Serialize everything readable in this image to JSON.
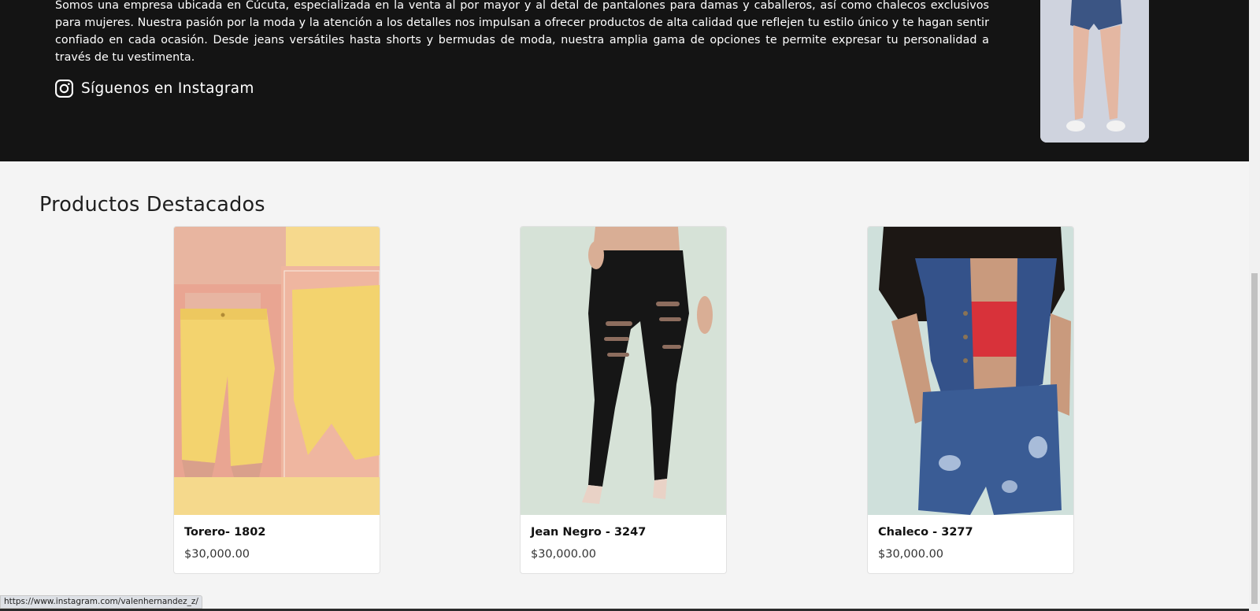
{
  "about": {
    "text": "Somos una empresa ubicada en Cúcuta, especializada en la venta al por mayor y al detal de pantalones para damas y caballeros, así como chalecos exclusivos para mujeres. Nuestra pasión por la moda y la atención a los detalles nos impulsan a ofrecer productos de alta calidad que reflejen tu estilo único y te hagan sentir confiado en cada ocasión. Desde jeans versátiles hasta shorts y bermudas de moda, nuestra amplia gama de opciones te permite expresar tu personalidad a través de tu vestimenta.",
    "instagram_label": "Síguenos en Instagram",
    "instagram_icon": "instagram-icon"
  },
  "products": {
    "title": "Productos Destacados",
    "items": [
      {
        "name": "Torero- 1802",
        "price": "$30,000.00"
      },
      {
        "name": "Jean Negro - 3247",
        "price": "$30,000.00"
      },
      {
        "name": "Chaleco - 3277",
        "price": "$30,000.00"
      }
    ]
  },
  "status_bar": {
    "url": "https://www.instagram.com/valenhernandez_z/"
  },
  "colors": {
    "dark_bg": "#141414",
    "page_bg": "#f4f4f4",
    "card_bg": "#ffffff"
  }
}
